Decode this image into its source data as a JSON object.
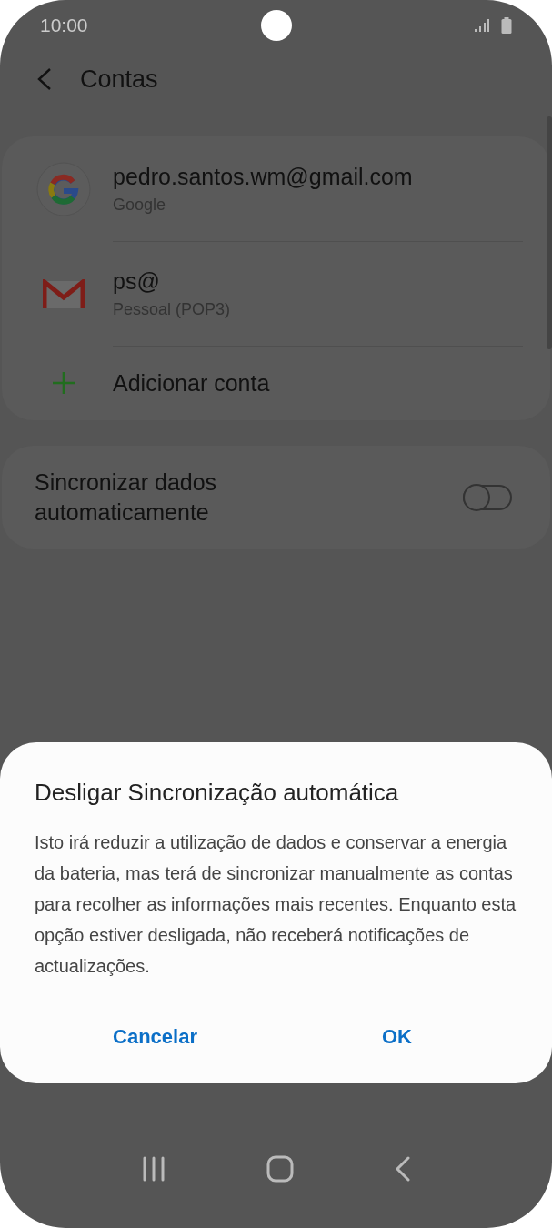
{
  "status_bar": {
    "time": "10:00"
  },
  "header": {
    "title": "Contas"
  },
  "accounts": [
    {
      "kind": "google",
      "email": "pedro.santos.wm@gmail.com",
      "type": "Google"
    },
    {
      "kind": "mail",
      "email": "ps@",
      "type": "Pessoal (POP3)"
    }
  ],
  "add_account": {
    "label": "Adicionar conta"
  },
  "sync": {
    "label": "Sincronizar dados automaticamente",
    "on": false
  },
  "dialog": {
    "title": "Desligar Sincronização automática",
    "message": "Isto irá reduzir a utilização de dados e conservar a energia da bateria, mas terá de sincronizar manualmente as contas para recolher as informações mais recentes. Enquanto esta opção estiver desligada, não receberá notificações de actualizações.",
    "buttons": [
      "Cancelar",
      "OK"
    ]
  }
}
